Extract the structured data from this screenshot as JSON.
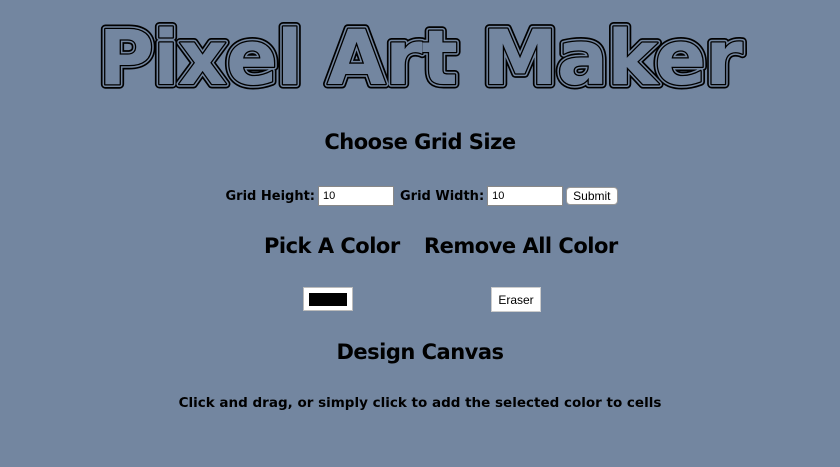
{
  "header": {
    "title": "Pixel Art Maker"
  },
  "grid_size": {
    "heading": "Choose Grid Size",
    "height_label": "Grid Height:",
    "height_value": "10",
    "width_label": "Grid Width:",
    "width_value": "10",
    "submit_label": "Submit"
  },
  "color": {
    "pick_heading": "Pick A Color",
    "selected_color": "#000000",
    "remove_heading": "Remove All Color",
    "eraser_label": "Eraser"
  },
  "canvas": {
    "heading": "Design Canvas",
    "hint": "Click and drag, or simply click to add the selected color to cells"
  },
  "colors": {
    "background": "#7386a0",
    "text": "#000000"
  }
}
